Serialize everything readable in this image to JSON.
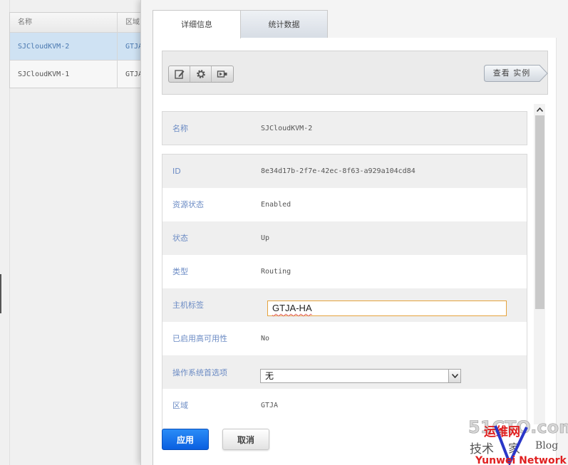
{
  "host_list": {
    "columns": [
      "名称",
      "区域"
    ],
    "rows": [
      {
        "name": "SJCloudKVM-2",
        "zone": "GTJA",
        "selected": true
      },
      {
        "name": "SJCloudKVM-1",
        "zone": "GTJA",
        "selected": false
      }
    ]
  },
  "dialog": {
    "tabs": [
      {
        "label": "详细信息",
        "active": true
      },
      {
        "label": "统计数据",
        "active": false
      }
    ],
    "toolbar": {
      "icons": [
        "edit-icon",
        "gear-icon",
        "maintenance-icon"
      ],
      "view_instances_label": "查看 实例"
    },
    "details": {
      "name": {
        "label": "名称",
        "value": "SJCloudKVM-2"
      },
      "fields": [
        {
          "label": "ID",
          "value": "8e34d17b-2f7e-42ec-8f63-a929a104cd84"
        },
        {
          "label": "资源状态",
          "value": "Enabled"
        },
        {
          "label": "状态",
          "value": "Up"
        },
        {
          "label": "类型",
          "value": "Routing"
        },
        {
          "label": "主机标签",
          "value": "GTJA-HA"
        },
        {
          "label": "已启用高可用性",
          "value": "No"
        },
        {
          "label": "操作系统首选项",
          "value": "无"
        },
        {
          "label": "区域",
          "value": "GTJA"
        }
      ]
    },
    "actions": {
      "apply_label": "应用",
      "cancel_label": "取消"
    }
  },
  "watermark": {
    "line1": "51CTO.com",
    "line2": "技术成就梦想",
    "line3": "Blog",
    "line4": "Yunwei Network",
    "brand": "运维网"
  },
  "colors": {
    "accent": "#1a73e8",
    "label": "#6b8bc4",
    "focus_border": "#e5a33d"
  }
}
